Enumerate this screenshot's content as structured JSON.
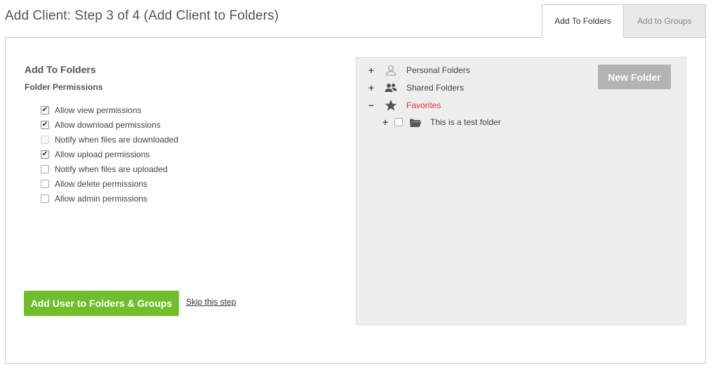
{
  "header": {
    "title": "Add Client: Step 3 of 4 (Add Client to Folders)"
  },
  "tabs": [
    {
      "label": "Add To Folders",
      "active": true
    },
    {
      "label": "Add to Groups",
      "active": false
    }
  ],
  "form": {
    "section_title": "Add To Folders",
    "section_subtitle": "Folder Permissions",
    "permissions": [
      {
        "label": "Allow view permissions",
        "checked": true,
        "enabled": true
      },
      {
        "label": "Allow download permissions",
        "checked": true,
        "enabled": true
      },
      {
        "label": "Notify when files are downloaded",
        "checked": false,
        "enabled": false
      },
      {
        "label": "Allow upload permissions",
        "checked": true,
        "enabled": true
      },
      {
        "label": "Notify when files are uploaded",
        "checked": false,
        "enabled": true
      },
      {
        "label": "Allow delete permissions",
        "checked": false,
        "enabled": true
      },
      {
        "label": "Allow admin permissions",
        "checked": false,
        "enabled": true
      }
    ],
    "submit_label": "Add User to Folders & Groups",
    "skip_label": "Skip this step"
  },
  "folder_tree": {
    "new_folder_label": "New Folder",
    "items": [
      {
        "label": "Personal Folders",
        "toggle": "+",
        "icon": "person-icon"
      },
      {
        "label": "Shared Folders",
        "toggle": "+",
        "icon": "people-icon"
      },
      {
        "label": "Favorites",
        "toggle": "−",
        "icon": "star-icon"
      },
      {
        "label": "This is a test folder",
        "toggle": "+",
        "icon": "folder-icon",
        "checked": false
      }
    ]
  },
  "colors": {
    "primary": "#6fbe2c",
    "favorites": "#d9363e",
    "new_folder_button": "#b3b3b3"
  }
}
